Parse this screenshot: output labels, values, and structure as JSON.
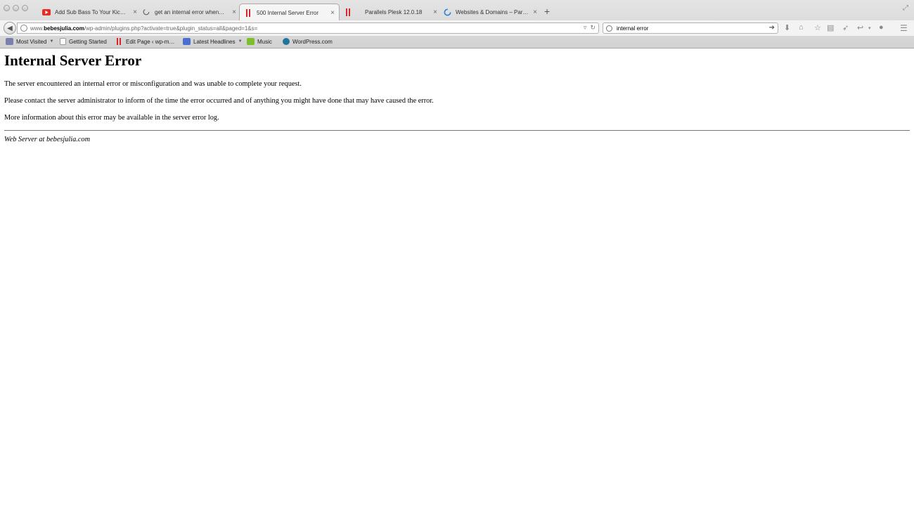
{
  "browser": {
    "tabs": [
      {
        "title": "Add Sub Bass To Your Kic…",
        "icon": "youtube-icon",
        "active": false
      },
      {
        "title": "get an internal error when…",
        "icon": "loading-circle-icon",
        "active": false
      },
      {
        "title": "500 Internal Server Error",
        "icon": "parallels-icon",
        "active": true
      },
      {
        "title": "Parallels Plesk 12.0.18",
        "icon": "parallels-icon",
        "active": false
      },
      {
        "title": "Websites & Domains – Par…",
        "icon": "loading-spinner-icon",
        "active": false
      }
    ],
    "close_glyph": "×",
    "new_tab_glyph": "+",
    "url": {
      "prefix": "www.",
      "domain": "bebesjulia.com",
      "path": "/wp-admin/plugins.php?activate=true&plugin_status=all&paged=1&s="
    },
    "search": {
      "value": "internal error"
    },
    "bookmarks": [
      {
        "label": "Most Visited",
        "icon": "most-visited-icon",
        "dropdown": true
      },
      {
        "label": "Getting Started",
        "icon": "page-icon",
        "dropdown": false
      },
      {
        "label": "Edit Page ‹ wp-m…",
        "icon": "parallels-icon",
        "dropdown": false
      },
      {
        "label": "Latest Headlines",
        "icon": "rss-icon",
        "dropdown": true
      },
      {
        "label": "Music",
        "icon": "music-icon",
        "dropdown": false
      },
      {
        "label": "WordPress.com",
        "icon": "wordpress-icon",
        "dropdown": false
      }
    ],
    "colors": {
      "youtube": "#e52d27",
      "parallels": "#d8262c",
      "spinner": "#2f7fd6",
      "wordpress": "#21759b",
      "rss": "#4a6fd1",
      "music": "#7cbf2a"
    }
  },
  "page": {
    "heading": "Internal Server Error",
    "paragraphs": [
      "The server encountered an internal error or misconfiguration and was unable to complete your request.",
      "Please contact the server administrator to inform of the time the error occurred and of anything you might have done that may have caused the error.",
      "More information about this error may be available in the server error log."
    ],
    "address": "Web Server at bebesjulia.com"
  }
}
